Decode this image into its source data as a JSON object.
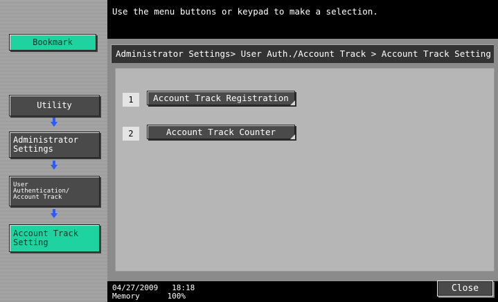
{
  "header": {
    "message": "Use the menu buttons or keypad to make a selection."
  },
  "sidebar": {
    "bookmark_label": "Bookmark",
    "steps": [
      {
        "label": "Utility"
      },
      {
        "label": "Administrator\nSettings"
      },
      {
        "label": "User\nAuthentication/\nAccount Track"
      },
      {
        "label": "Account Track\nSetting"
      }
    ]
  },
  "main": {
    "breadcrumb": "Administrator Settings> User Auth./Account Track > Account Track Setting",
    "items": [
      {
        "number": "1",
        "label": "Account Track Registration"
      },
      {
        "number": "2",
        "label": "Account Track Counter"
      }
    ]
  },
  "footer": {
    "date": "04/27/2009",
    "time": "18:18",
    "memory_label": "Memory",
    "memory_value": "100%",
    "close_label": "Close"
  },
  "colors": {
    "selected_green": "#1fd3a0",
    "button_gray": "#4a4a4a"
  }
}
